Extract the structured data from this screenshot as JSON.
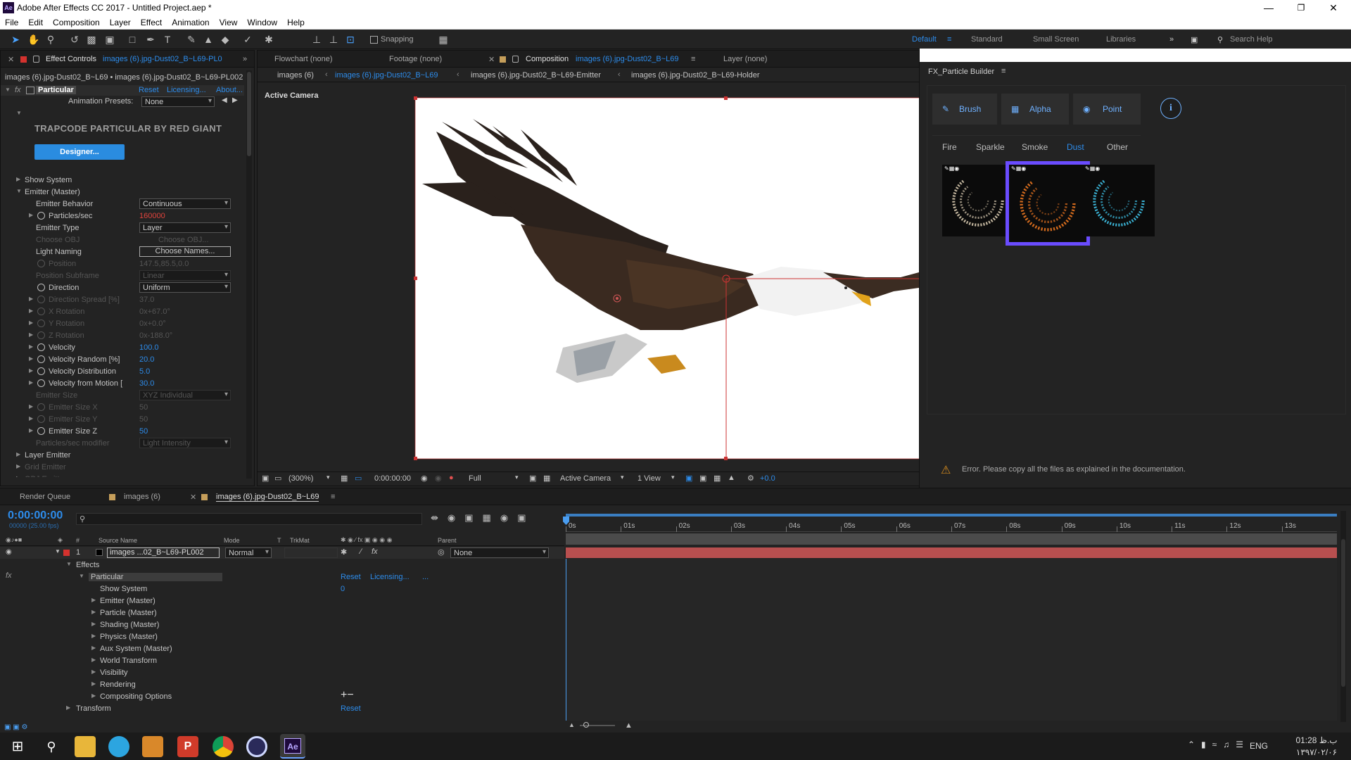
{
  "titlebar": {
    "logo": "Ae",
    "title": "Adobe After Effects CC 2017 - Untitled Project.aep *"
  },
  "window_controls": [
    "minimize-icon",
    "maximize-icon",
    "close-icon"
  ],
  "menu": [
    "File",
    "Edit",
    "Composition",
    "Layer",
    "Effect",
    "Animation",
    "View",
    "Window",
    "Help"
  ],
  "toolbar": {
    "snapping": "Snapping",
    "workspaces": [
      "Default",
      "Standard",
      "Small Screen",
      "Libraries"
    ],
    "search": "Search Help"
  },
  "effect_controls": {
    "tab_label": "Effect Controls",
    "tab_layer": "images (6).jpg-Dust02_B~L69-PL0",
    "breadcrumb": "images (6).jpg-Dust02_B~L69 • images (6).jpg-Dust02_B~L69-PL002",
    "effect_name": "Particular",
    "reset": "Reset",
    "licensing": "Licensing...",
    "about": "About...",
    "presets_label": "Animation Presets:",
    "presets_value": "None",
    "brand": "TRAPCODE PARTICULAR BY RED GIANT",
    "designer_button": "Designer...",
    "rows": [
      {
        "label": "Show System",
        "indent": 1,
        "tri": "▶",
        "value": "",
        "dim": false
      },
      {
        "label": "Emitter (Master)",
        "indent": 1,
        "tri": "▼",
        "value": "",
        "dim": false
      },
      {
        "label": "Emitter Behavior",
        "indent": 2,
        "tri": "",
        "value": "Continuous",
        "dd": true,
        "dim": false
      },
      {
        "label": "Particles/sec",
        "indent": 2,
        "tri": "▶",
        "sw": true,
        "value": "160000",
        "color": "#e0433c",
        "dim": false
      },
      {
        "label": "Emitter Type",
        "indent": 2,
        "tri": "",
        "value": "Layer",
        "dd": true,
        "dim": false
      },
      {
        "label": "Choose OBJ",
        "indent": 2,
        "tri": "",
        "value": "Choose OBJ...",
        "dim": true
      },
      {
        "label": "Light Naming",
        "indent": 2,
        "tri": "",
        "value": "Choose Names...",
        "btn": true,
        "dim": false
      },
      {
        "label": "Position",
        "indent": 2,
        "tri": "",
        "sw": true,
        "value": "147.5,85.5,0.0",
        "dim": true
      },
      {
        "label": "Position Subframe",
        "indent": 2,
        "tri": "",
        "value": "Linear",
        "dd": true,
        "dim": true
      },
      {
        "label": "Direction",
        "indent": 2,
        "tri": "",
        "sw": true,
        "value": "Uniform",
        "dd": true,
        "dim": false
      },
      {
        "label": "Direction Spread [%]",
        "indent": 2,
        "tri": "▶",
        "sw": true,
        "value": "37.0",
        "dim": true
      },
      {
        "label": "X Rotation",
        "indent": 2,
        "tri": "▶",
        "sw": true,
        "value": "0x+67.0°",
        "dim": true
      },
      {
        "label": "Y Rotation",
        "indent": 2,
        "tri": "▶",
        "sw": true,
        "value": "0x+0.0°",
        "dim": true
      },
      {
        "label": "Z Rotation",
        "indent": 2,
        "tri": "▶",
        "sw": true,
        "value": "0x-188.0°",
        "dim": true
      },
      {
        "label": "Velocity",
        "indent": 2,
        "tri": "▶",
        "sw": true,
        "value": "100.0",
        "color": "#2d8ceb",
        "dim": false
      },
      {
        "label": "Velocity Random [%]",
        "indent": 2,
        "tri": "▶",
        "sw": true,
        "value": "20.0",
        "color": "#2d8ceb",
        "dim": false
      },
      {
        "label": "Velocity Distribution",
        "indent": 2,
        "tri": "▶",
        "sw": true,
        "value": "5.0",
        "color": "#2d8ceb",
        "dim": false
      },
      {
        "label": "Velocity from Motion [",
        "indent": 2,
        "tri": "▶",
        "sw": true,
        "value": "30.0",
        "color": "#2d8ceb",
        "dim": false
      },
      {
        "label": "Emitter Size",
        "indent": 2,
        "tri": "",
        "value": "XYZ Individual",
        "dd": true,
        "dim": true
      },
      {
        "label": "Emitter Size X",
        "indent": 2,
        "tri": "▶",
        "sw": true,
        "value": "50",
        "dim": true
      },
      {
        "label": "Emitter Size Y",
        "indent": 2,
        "tri": "▶",
        "sw": true,
        "value": "50",
        "dim": true
      },
      {
        "label": "Emitter Size Z",
        "indent": 2,
        "tri": "▶",
        "sw": true,
        "value": "50",
        "color": "#2d8ceb",
        "dim": false
      },
      {
        "label": "Particles/sec modifier",
        "indent": 2,
        "tri": "",
        "value": "Light Intensity",
        "dd": true,
        "dim": true
      },
      {
        "label": "Layer Emitter",
        "indent": 1,
        "tri": "▶",
        "value": "",
        "dim": false
      },
      {
        "label": "Grid Emitter",
        "indent": 1,
        "tri": "▶",
        "value": "",
        "dim": true
      },
      {
        "label": "OBJ Emitter",
        "indent": 1,
        "tri": "▶",
        "value": "",
        "dim": true
      }
    ]
  },
  "viewer_tabs": {
    "flowchart": "Flowchart (none)",
    "footage": "Footage (none)",
    "composition_prefix": "Composition",
    "composition_name": "images (6).jpg-Dust02_B~L69",
    "layer": "Layer (none)",
    "breadcrumbs": [
      "images (6)",
      "images (6).jpg-Dust02_B~L69",
      "images (6).jpg-Dust02_B~L69-Emitter",
      "images (6).jpg-Dust02_B~L69-Holder"
    ],
    "active_camera": "Active Camera"
  },
  "viewer_footer": {
    "zoom": "(300%)",
    "timecode": "0:00:00:00",
    "resolution": "Full",
    "camera": "Active Camera",
    "views": "1 View",
    "exposure": "+0.0"
  },
  "fx_builder": {
    "title": "FX_Particle Builder",
    "modes": [
      "Brush",
      "Alpha",
      "Point"
    ],
    "info_icon": "i",
    "categories": [
      "Fire",
      "Sparkle",
      "Smoke",
      "Dust",
      "Other"
    ],
    "active_category": "Dust",
    "selected_thumb": 1,
    "thumb_colors": [
      "#d9cbb0",
      "#e8741f",
      "#3fc4ea"
    ],
    "error": "Error. Please copy all the files as explained in the documentation."
  },
  "timeline": {
    "tabs": [
      "Render Queue",
      "images (6)",
      "images (6).jpg-Dust02_B~L69"
    ],
    "timecode": "0:00:00:00",
    "fps": "00000 (25.00 fps)",
    "columns": [
      "#",
      "Source Name",
      "Mode",
      "T",
      "TrkMat",
      "Parent"
    ],
    "layer": {
      "num": "1",
      "name": "images ...02_B~L69-PL002",
      "mode": "Normal",
      "parent": "None"
    },
    "ruler": [
      "0s",
      "01s",
      "02s",
      "03s",
      "04s",
      "05s",
      "06s",
      "07s",
      "08s",
      "09s",
      "10s",
      "11s",
      "12s",
      "13s"
    ],
    "tree": [
      {
        "label": "Effects",
        "level": 0,
        "tri": "▼"
      },
      {
        "label": "Particular",
        "level": 1,
        "tri": "▼",
        "highlight": true,
        "extra": [
          "Reset",
          "Licensing...",
          "..."
        ]
      },
      {
        "label": "Show System",
        "level": 2,
        "tri": "",
        "value": "0"
      },
      {
        "label": "Emitter (Master)",
        "level": 2,
        "tri": "▶"
      },
      {
        "label": "Particle (Master)",
        "level": 2,
        "tri": "▶"
      },
      {
        "label": "Shading (Master)",
        "level": 2,
        "tri": "▶"
      },
      {
        "label": "Physics (Master)",
        "level": 2,
        "tri": "▶"
      },
      {
        "label": "Aux System (Master)",
        "level": 2,
        "tri": "▶"
      },
      {
        "label": "World Transform",
        "level": 2,
        "tri": "▶"
      },
      {
        "label": "Visibility",
        "level": 2,
        "tri": "▶"
      },
      {
        "label": "Rendering",
        "level": 2,
        "tri": "▶"
      },
      {
        "label": "Compositing Options",
        "level": 2,
        "tri": "▶"
      },
      {
        "label": "Transform",
        "level": 0,
        "tri": "▶",
        "value": "Reset"
      }
    ]
  },
  "taskbar": {
    "apps": [
      "windows-start-icon",
      "search-icon",
      "file-explorer-icon",
      "telegram-icon",
      "media-player-icon",
      "wps-presentation-icon",
      "chrome-icon",
      "cinema4d-icon",
      "after-effects-icon"
    ],
    "language": "ENG",
    "time": "01:28 ب.ظ",
    "date": "۱۳۹۷/۰۲/۰۶"
  }
}
